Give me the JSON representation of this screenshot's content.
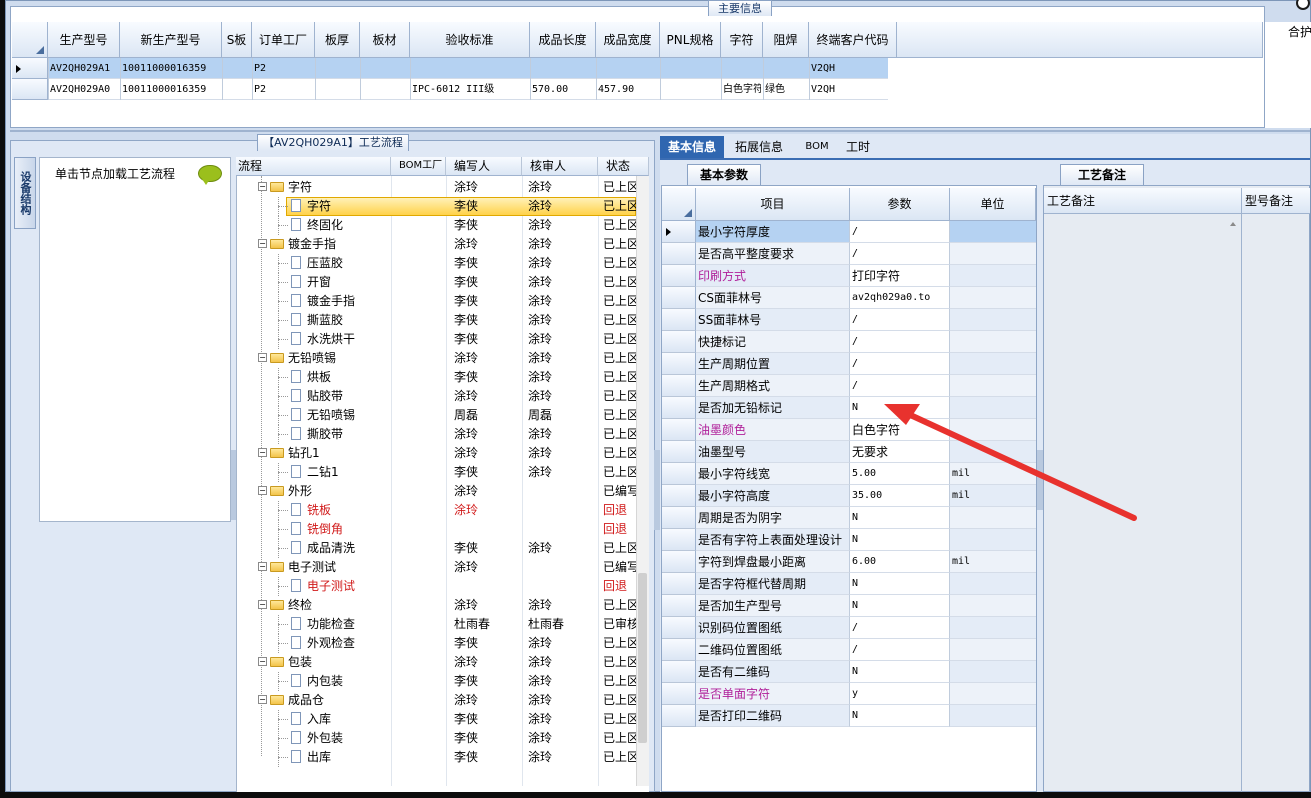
{
  "top": {
    "title": "主要信息",
    "right_header": "合护",
    "columns": [
      "生产型号",
      "新生产型号",
      "S板",
      "订单工厂",
      "板厚",
      "板材",
      "验收标准",
      "成品长度",
      "成品宽度",
      "PNL规格",
      "字符",
      "阻焊",
      "终端客户代码"
    ],
    "rows": [
      {
        "selected": true,
        "cells": [
          "AV2QH029A1",
          "10011000016359",
          "",
          "P2",
          "",
          "",
          "",
          "",
          "",
          "",
          "",
          "",
          "V2QH"
        ]
      },
      {
        "selected": false,
        "cells": [
          "AV2QH029A0",
          "10011000016359",
          "",
          "P2",
          "",
          "",
          "IPC-6012 III级",
          "570.00",
          "457.90",
          "",
          "白色字符",
          "绿色",
          "V2QH"
        ]
      }
    ]
  },
  "flow": {
    "title": "【AV2QH029A1】工艺流程",
    "side_tab": "设备结构",
    "hint": "单击节点加载工艺流程",
    "columns": [
      "流程",
      "BOM工厂",
      "编写人",
      "核审人",
      "状态"
    ],
    "rows": [
      {
        "level": 0,
        "name": "字符",
        "author": "涂玲",
        "reviewer": "涂玲",
        "status": "已上区",
        "style": "normal"
      },
      {
        "level": 1,
        "name": "字符",
        "author": "李侠",
        "reviewer": "涂玲",
        "status": "已上区",
        "style": "selected"
      },
      {
        "level": 1,
        "name": "终固化",
        "author": "李侠",
        "reviewer": "涂玲",
        "status": "已上区",
        "style": "normal"
      },
      {
        "level": 0,
        "name": "镀金手指",
        "author": "涂玲",
        "reviewer": "涂玲",
        "status": "已上区",
        "style": "normal"
      },
      {
        "level": 1,
        "name": "压蓝胶",
        "author": "李侠",
        "reviewer": "涂玲",
        "status": "已上区",
        "style": "normal"
      },
      {
        "level": 1,
        "name": "开窗",
        "author": "李侠",
        "reviewer": "涂玲",
        "status": "已上区",
        "style": "normal"
      },
      {
        "level": 1,
        "name": "镀金手指",
        "author": "李侠",
        "reviewer": "涂玲",
        "status": "已上区",
        "style": "normal"
      },
      {
        "level": 1,
        "name": "撕蓝胶",
        "author": "李侠",
        "reviewer": "涂玲",
        "status": "已上区",
        "style": "normal"
      },
      {
        "level": 1,
        "name": "水洗烘干",
        "author": "李侠",
        "reviewer": "涂玲",
        "status": "已上区",
        "style": "normal"
      },
      {
        "level": 0,
        "name": "无铅喷锡",
        "author": "涂玲",
        "reviewer": "涂玲",
        "status": "已上区",
        "style": "normal"
      },
      {
        "level": 1,
        "name": "烘板",
        "author": "李侠",
        "reviewer": "涂玲",
        "status": "已上区",
        "style": "normal"
      },
      {
        "level": 1,
        "name": "贴胶带",
        "author": "涂玲",
        "reviewer": "涂玲",
        "status": "已上区",
        "style": "normal"
      },
      {
        "level": 1,
        "name": "无铅喷锡",
        "author": "周磊",
        "reviewer": "周磊",
        "status": "已上区",
        "style": "normal"
      },
      {
        "level": 1,
        "name": "撕胶带",
        "author": "涂玲",
        "reviewer": "涂玲",
        "status": "已上区",
        "style": "normal"
      },
      {
        "level": 0,
        "name": "钻孔1",
        "author": "涂玲",
        "reviewer": "涂玲",
        "status": "已上区",
        "style": "normal"
      },
      {
        "level": 1,
        "name": "二钻1",
        "author": "李侠",
        "reviewer": "涂玲",
        "status": "已上区",
        "style": "normal"
      },
      {
        "level": 0,
        "name": "外形",
        "author": "涂玲",
        "reviewer": "",
        "status": "已编写",
        "style": "normal"
      },
      {
        "level": 1,
        "name": "铣板",
        "author": "涂玲",
        "reviewer": "",
        "status": "回退",
        "style": "red"
      },
      {
        "level": 1,
        "name": "铣倒角",
        "author": "",
        "reviewer": "",
        "status": "回退",
        "style": "red"
      },
      {
        "level": 1,
        "name": "成品清洗",
        "author": "李侠",
        "reviewer": "涂玲",
        "status": "已上区",
        "style": "normal"
      },
      {
        "level": 0,
        "name": "电子测试",
        "author": "涂玲",
        "reviewer": "",
        "status": "已编写",
        "style": "normal"
      },
      {
        "level": 1,
        "name": "电子测试",
        "author": "",
        "reviewer": "",
        "status": "回退",
        "style": "red"
      },
      {
        "level": 0,
        "name": "终检",
        "author": "涂玲",
        "reviewer": "涂玲",
        "status": "已上区",
        "style": "normal"
      },
      {
        "level": 1,
        "name": "功能检查",
        "author": "杜雨春",
        "reviewer": "杜雨春",
        "status": "已审核",
        "style": "normal"
      },
      {
        "level": 1,
        "name": "外观检查",
        "author": "李侠",
        "reviewer": "涂玲",
        "status": "已上区",
        "style": "normal"
      },
      {
        "level": 0,
        "name": "包装",
        "author": "涂玲",
        "reviewer": "涂玲",
        "status": "已上区",
        "style": "normal"
      },
      {
        "level": 1,
        "name": "内包装",
        "author": "李侠",
        "reviewer": "涂玲",
        "status": "已上区",
        "style": "normal"
      },
      {
        "level": 0,
        "name": "成品仓",
        "author": "涂玲",
        "reviewer": "涂玲",
        "status": "已上区",
        "style": "normal"
      },
      {
        "level": 1,
        "name": "入库",
        "author": "李侠",
        "reviewer": "涂玲",
        "status": "已上区",
        "style": "normal"
      },
      {
        "level": 1,
        "name": "外包装",
        "author": "李侠",
        "reviewer": "涂玲",
        "status": "已上区",
        "style": "normal"
      },
      {
        "level": 1,
        "name": "出库",
        "author": "李侠",
        "reviewer": "涂玲",
        "status": "已上区",
        "style": "normal"
      }
    ]
  },
  "detail": {
    "tabs": [
      "基本信息",
      "拓展信息",
      "BOM",
      "工时"
    ],
    "active_tab": 0,
    "subtab": "基本参数",
    "columns": [
      "项目",
      "参数",
      "单位"
    ],
    "rows": [
      {
        "item": "最小字符厚度",
        "value": "/",
        "unit": "",
        "color": "normal"
      },
      {
        "item": "是否高平整度要求",
        "value": "/",
        "unit": "",
        "color": "normal"
      },
      {
        "item": "印刷方式",
        "value": "打印字符",
        "unit": "",
        "color": "magenta"
      },
      {
        "item": "CS面菲林号",
        "value": "av2qh029a0.to",
        "unit": "",
        "color": "normal"
      },
      {
        "item": "SS面菲林号",
        "value": "/",
        "unit": "",
        "color": "normal"
      },
      {
        "item": "快捷标记",
        "value": "/",
        "unit": "",
        "color": "normal"
      },
      {
        "item": "生产周期位置",
        "value": "/",
        "unit": "",
        "color": "normal"
      },
      {
        "item": "生产周期格式",
        "value": "/",
        "unit": "",
        "color": "normal"
      },
      {
        "item": "是否加无铅标记",
        "value": "N",
        "unit": "",
        "color": "normal"
      },
      {
        "item": "油墨颜色",
        "value": "白色字符",
        "unit": "",
        "color": "magenta"
      },
      {
        "item": "油墨型号",
        "value": "无要求",
        "unit": "",
        "color": "normal"
      },
      {
        "item": "最小字符线宽",
        "value": "5.00",
        "unit": "mil",
        "color": "normal"
      },
      {
        "item": "最小字符高度",
        "value": "35.00",
        "unit": "mil",
        "color": "normal"
      },
      {
        "item": "周期是否为阴字",
        "value": "N",
        "unit": "",
        "color": "normal"
      },
      {
        "item": "是否有字符上表面处理设计",
        "value": "N",
        "unit": "",
        "color": "normal"
      },
      {
        "item": "字符到焊盘最小距离",
        "value": "6.00",
        "unit": "mil",
        "color": "normal"
      },
      {
        "item": "是否字符框代替周期",
        "value": "N",
        "unit": "",
        "color": "normal"
      },
      {
        "item": "是否加生产型号",
        "value": "N",
        "unit": "",
        "color": "normal"
      },
      {
        "item": "识别码位置图纸",
        "value": "/",
        "unit": "",
        "color": "normal"
      },
      {
        "item": "二维码位置图纸",
        "value": "/",
        "unit": "",
        "color": "normal"
      },
      {
        "item": "是否有二维码",
        "value": "N",
        "unit": "",
        "color": "normal"
      },
      {
        "item": "是否单面字符",
        "value": "y",
        "unit": "",
        "color": "magenta"
      },
      {
        "item": "是否打印二维码",
        "value": "N",
        "unit": "",
        "color": "normal"
      }
    ]
  },
  "remarks": {
    "tab": "工艺备注",
    "columns": [
      "工艺备注",
      "型号备注"
    ]
  },
  "colors": {
    "selection": "#b5d2f2",
    "annotation_arrow": "#e8322e"
  }
}
